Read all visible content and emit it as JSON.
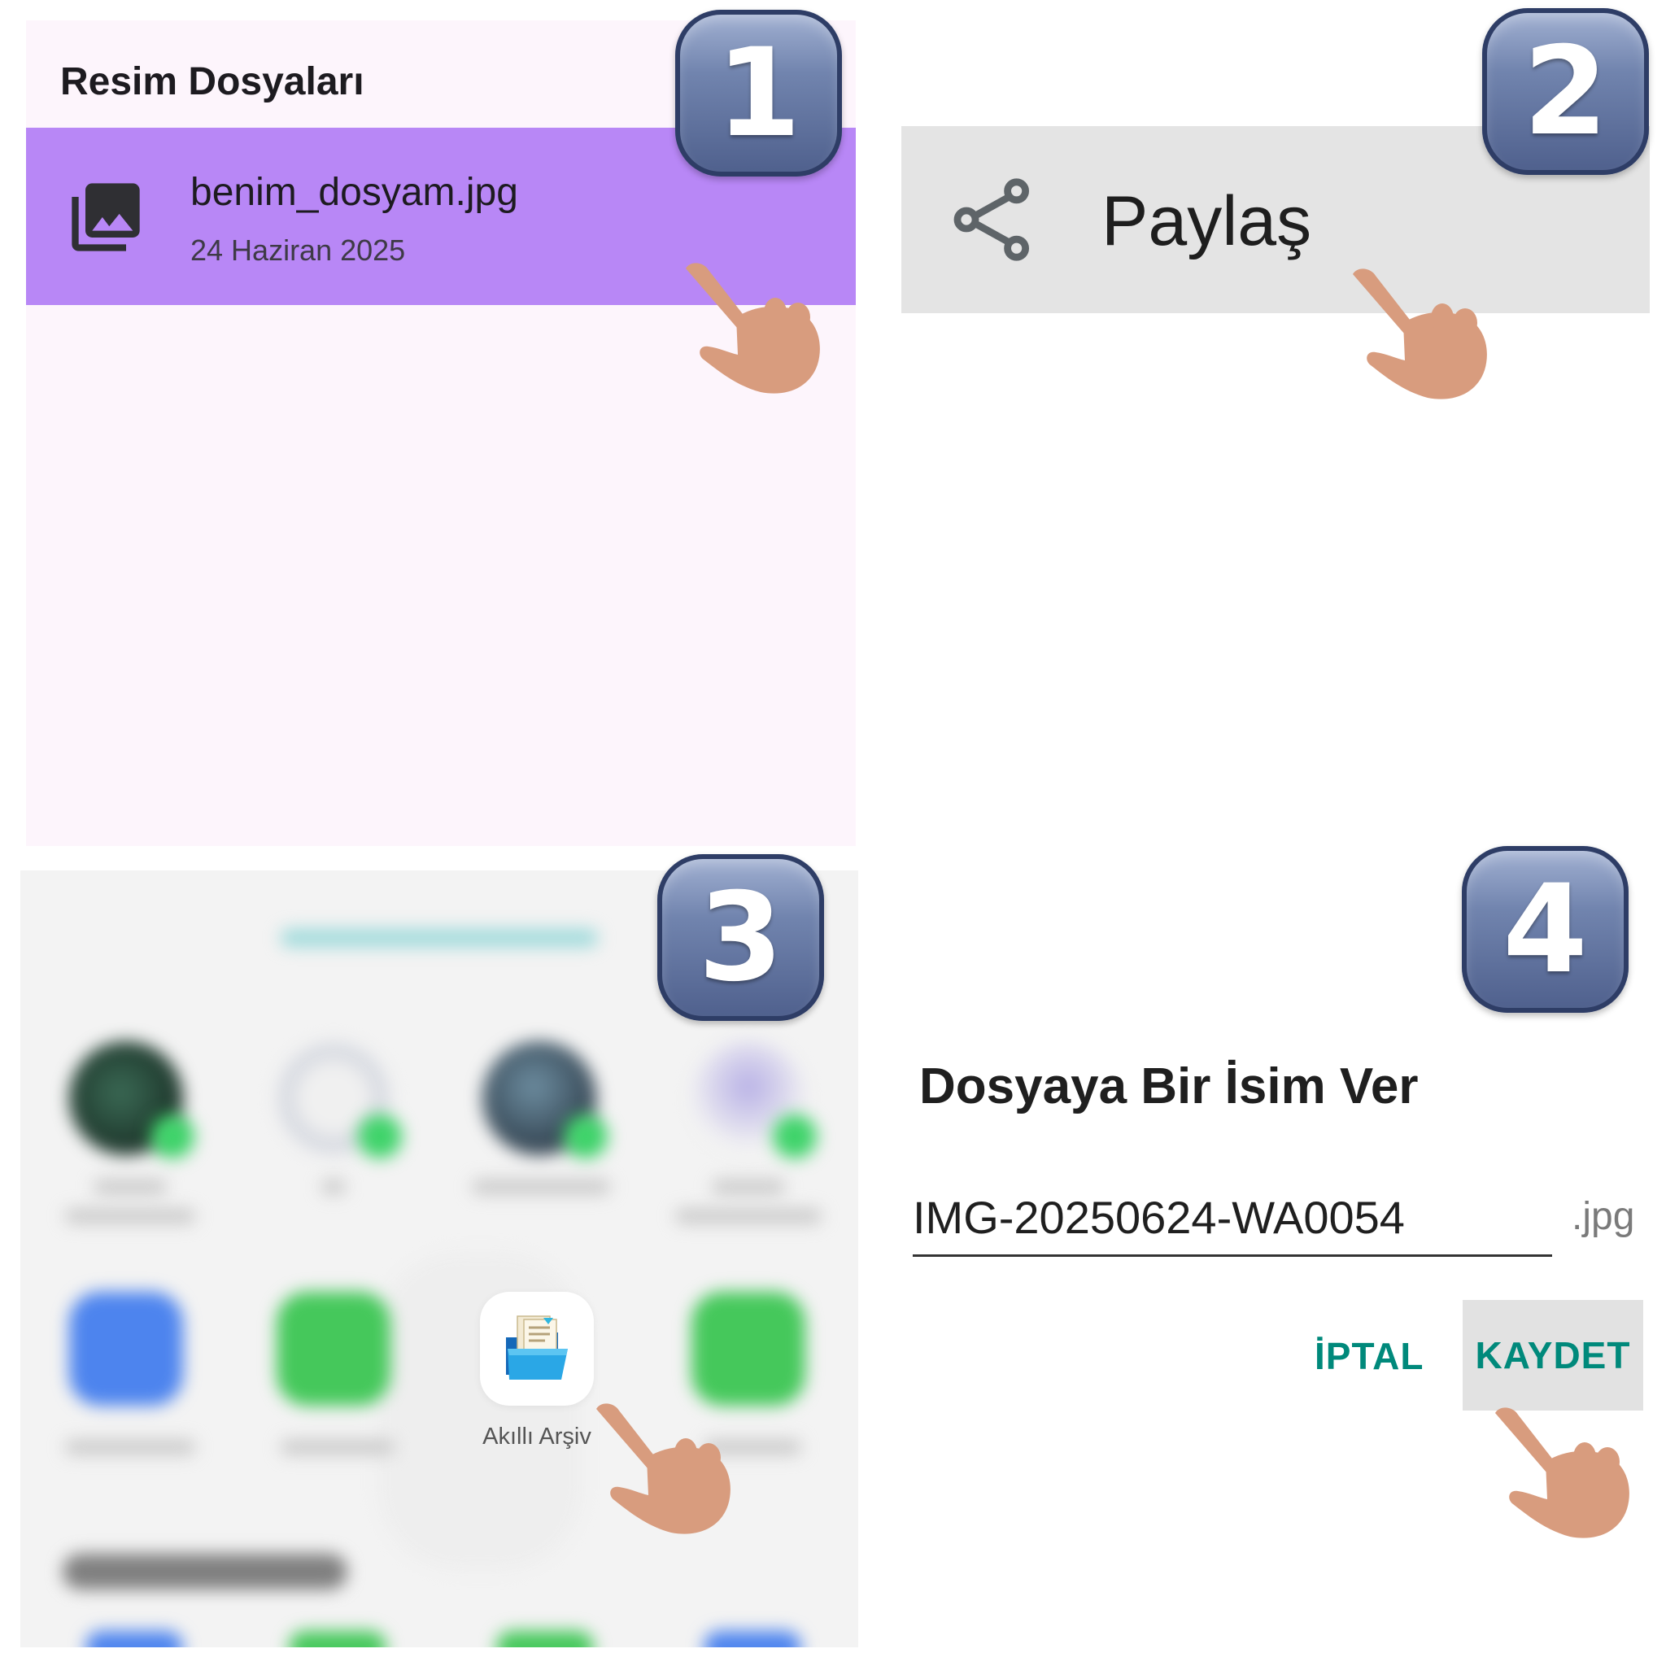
{
  "steps": [
    "1",
    "2",
    "3",
    "4"
  ],
  "panel1": {
    "title": "Resim Dosyaları",
    "file": {
      "name": "benim_dosyam.jpg",
      "date": "24 Haziran 2025",
      "icon": "photo-library-icon"
    },
    "highlight_color": "#b887f6"
  },
  "panel2": {
    "share_label": "Paylaş",
    "icon": "share-icon"
  },
  "panel3": {
    "highlighted_app": {
      "label": "Akıllı Arşiv",
      "icon": "folder-documents-icon"
    }
  },
  "panel4": {
    "title": "Dosyaya Bir İsim Ver",
    "filename_value": "IMG-20250624-WA0054",
    "extension": ".jpg",
    "cancel_label": "İPTAL",
    "save_label": "KAYDET",
    "accent_color": "#00897b"
  }
}
